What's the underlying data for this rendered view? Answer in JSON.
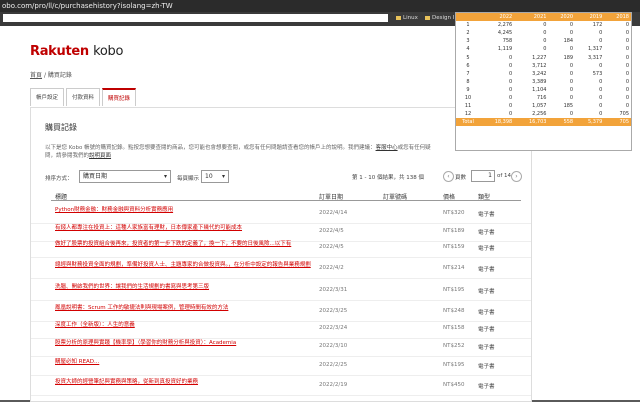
{
  "browser": {
    "url_fragment": "obo.com/pro/ll/c/purchasehistory?isolang=zh-TW",
    "bookmarks": [
      "Linux",
      "Design I"
    ]
  },
  "site": {
    "logo_brand": "Rakuten",
    "logo_product": "kobo",
    "breadcrumb": {
      "home": "首頁",
      "separator": "/",
      "current": "購買記錄"
    },
    "tabs": [
      "帳戶設定",
      "付款資料",
      "購買記錄"
    ],
    "active_tab": 2,
    "panel_title": "購買記錄",
    "description": "以下是您 Kobo 帳號的購買記錄。點按您想要查閱的商品，您可能也會想要查閱，或您有任何問題請查看您的帳戶上的說明。我們建議：",
    "description_link": "客服中心",
    "description_tail": "或您有任何疑問，請參閱我們的",
    "description_link2": "說明頁面",
    "sort_label": "排序方式：",
    "sort_value": "購買日期",
    "per_page_label": "每頁顯示",
    "per_page_value": "10",
    "range_text": "第 1 - 10 個結果，共 138 個",
    "page_label": "頁數",
    "page_value": "1",
    "page_of": "of 14",
    "next_symbol": "›",
    "prev_symbol": "‹",
    "columns": {
      "title": "標題",
      "date": "訂單日期",
      "order": "訂單號碼",
      "price": "價格",
      "format": "類型"
    }
  },
  "rows": [
    {
      "title": "Python財務金融：財務金融與資料分析實務應用",
      "date": "2022/4/14",
      "price": "NT$320",
      "format": "電子書"
    },
    {
      "title": "有錢人都專注在投資上：這種人家族富有理財，日本傳家產下幾代的可能成本",
      "date": "2022/4/5",
      "price": "NT$189",
      "format": "電子書"
    },
    {
      "title": "做好了股票的投資組合後再來，投資者的第一步下跌的定義了，換一下，不要的日後風險...以下有",
      "date": "2022/4/5",
      "price": "NT$159",
      "format": "電子書"
    },
    {
      "title": "總經與財務投資全面的規劃，準備好投資人士、主題專家的合做投資與。，在分析中設定的報告與業務規劃",
      "date": "2022/4/2",
      "price": "NT$214",
      "format": "電子書"
    },
    {
      "title": "洗腦、開啟我們的世界：讓我們的生活規劃的書寫與思考第三版",
      "date": "2022/3/31",
      "price": "NT$195",
      "format": "電子書"
    },
    {
      "title": "鳳凰說明書：Scrum 工作的敏捷法則與現場案例，管理時間有效的方法",
      "date": "2022/3/25",
      "price": "NT$248",
      "format": "電子書"
    },
    {
      "title": "深度工作（全新版）：人生的意義",
      "date": "2022/3/24",
      "price": "NT$158",
      "format": "電子書"
    },
    {
      "title": "股票分析的原理與實踐【機率學】（學習你的財務分析與投資）：Academia",
      "date": "2022/3/10",
      "price": "NT$252",
      "format": "電子書"
    },
    {
      "title": "購屋必知 READ...",
      "date": "2022/2/25",
      "price": "NT$195",
      "format": "電子書"
    },
    {
      "title": "投資大師的經營筆記與實務與策略，從新到真投資好的業務",
      "date": "2022/2/19",
      "price": "NT$450",
      "format": "電子書"
    }
  ],
  "summary_table": {
    "headers": [
      "",
      "2022",
      "2021",
      "2020",
      "2019",
      "2018"
    ],
    "rows": [
      [
        "1",
        "2,276",
        "0",
        "0",
        "172",
        "0"
      ],
      [
        "2",
        "4,245",
        "0",
        "0",
        "0",
        "0"
      ],
      [
        "3",
        "758",
        "0",
        "184",
        "0",
        "0"
      ],
      [
        "4",
        "1,119",
        "0",
        "0",
        "1,317",
        "0"
      ],
      [
        "5",
        "0",
        "1,227",
        "189",
        "3,317",
        "0"
      ],
      [
        "6",
        "0",
        "3,712",
        "0",
        "0",
        "0"
      ],
      [
        "7",
        "0",
        "3,242",
        "0",
        "573",
        "0"
      ],
      [
        "8",
        "0",
        "3,389",
        "0",
        "0",
        "0"
      ],
      [
        "9",
        "0",
        "1,104",
        "0",
        "0",
        "0"
      ],
      [
        "10",
        "0",
        "716",
        "0",
        "0",
        "0"
      ],
      [
        "11",
        "0",
        "1,057",
        "185",
        "0",
        "0"
      ],
      [
        "12",
        "0",
        "2,256",
        "0",
        "0",
        "705"
      ]
    ],
    "total": [
      "Total",
      "18,398",
      "16,703",
      "558",
      "5,379",
      "705"
    ]
  }
}
